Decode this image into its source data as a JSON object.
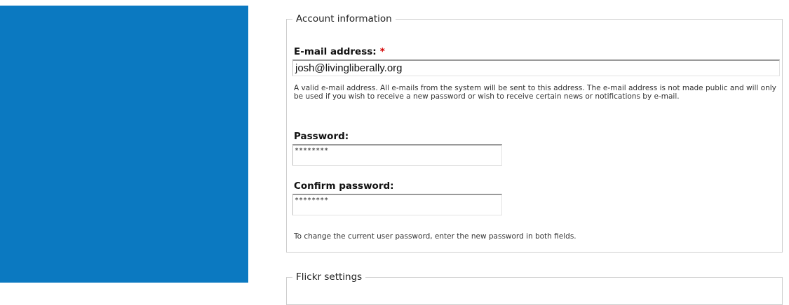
{
  "colors": {
    "sidebar": "#0b79c1",
    "required_marker": "#d40000",
    "fieldset_border": "#cfcfcf"
  },
  "account": {
    "legend": "Account information",
    "email": {
      "label": "E-mail address:",
      "required_marker": "*",
      "value": "josh@livingliberally.org",
      "description": "A valid e-mail address. All e-mails from the system will be sent to this address. The e-mail address is not made public and will only be used if you wish to receive a new password or wish to receive certain news or notifications by e-mail."
    },
    "password": {
      "label": "Password:",
      "value": "********"
    },
    "confirm_password": {
      "label": "Confirm password:",
      "value": "********"
    },
    "password_help": "To change the current user password, enter the new password in both fields."
  },
  "flickr": {
    "legend": "Flickr settings"
  }
}
